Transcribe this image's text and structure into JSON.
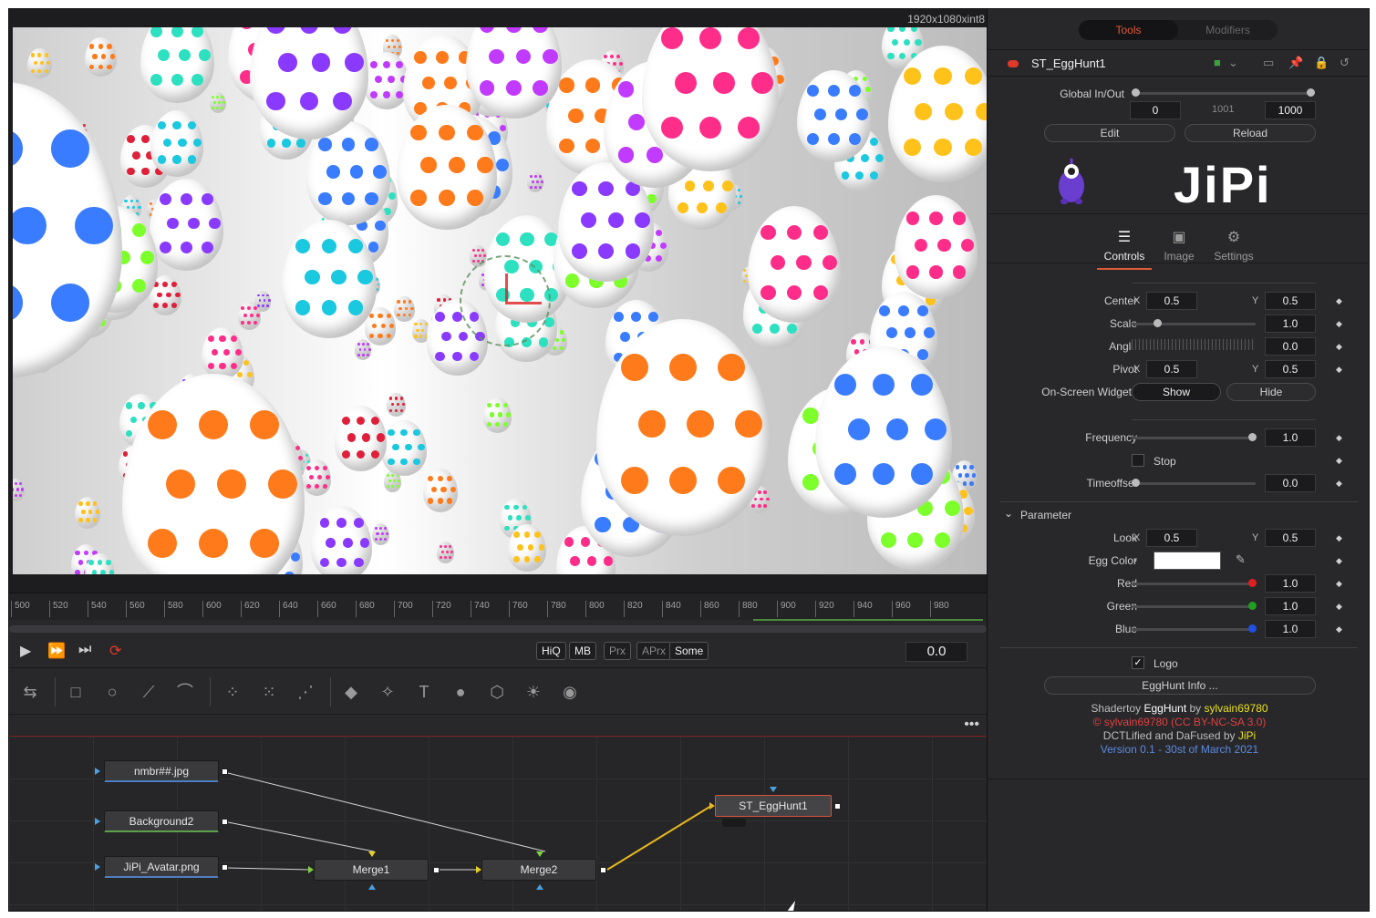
{
  "viewer": {
    "resolution": "1920x1080xint8"
  },
  "ruler": {
    "ticks": [
      "500",
      "520",
      "540",
      "560",
      "580",
      "600",
      "620",
      "640",
      "660",
      "680",
      "700",
      "720",
      "740",
      "760",
      "780",
      "800",
      "820",
      "840",
      "860",
      "880",
      "900",
      "920",
      "940",
      "960",
      "980"
    ]
  },
  "transport": {
    "quality_buttons": [
      "HiQ",
      "MB",
      "Prx",
      "APrx",
      "Some"
    ],
    "time": "0.0"
  },
  "nodes": {
    "n1": "nmbr##.jpg",
    "n2": "Background2",
    "n3": "JiPi_Avatar.png",
    "merge1": "Merge1",
    "merge2": "Merge2",
    "st": "ST_EggHunt1"
  },
  "inspector": {
    "tabs": {
      "tools": "Tools",
      "modifiers": "Modifiers"
    },
    "tool_name": "ST_EggHunt1",
    "global_inout_label": "Global In/Out",
    "global_in": "0",
    "global_mid": "1001",
    "global_out": "1000",
    "edit_label": "Edit",
    "reload_label": "Reload",
    "logo_text": "JiPi",
    "ctrl_tabs": {
      "controls": "Controls",
      "image": "Image",
      "settings": "Settings"
    },
    "center_label": "Center",
    "center_x": "0.5",
    "center_y": "0.5",
    "scale_label": "Scale",
    "scale": "1.0",
    "angle_label": "Angle",
    "angle": "0.0",
    "pivot_label": "Pivot",
    "pivot_x": "0.5",
    "pivot_y": "0.5",
    "widgets_label": "On-Screen Widgets",
    "show": "Show",
    "hide": "Hide",
    "frequency_label": "Frequency",
    "frequency": "1.0",
    "stop_label": "Stop",
    "timeoffset_label": "Timeoffset",
    "timeoffset": "0.0",
    "parameter_label": "Parameter",
    "look_label": "Look",
    "look_x": "0.5",
    "look_y": "0.5",
    "eggcolor_label": "Egg Color",
    "red_label": "Red",
    "red": "1.0",
    "green_label": "Green",
    "green": "1.0",
    "blue_label": "Blue",
    "blue": "1.0",
    "logo_label": "Logo",
    "info_label": "EggHunt Info ...",
    "x_axis": "X",
    "y_axis": "Y"
  },
  "credits": {
    "line1_a": "Shadertoy ",
    "line1_b": "EggHunt",
    "line1_c": " by ",
    "line1_d": "sylvain69780",
    "line2": "© sylvain69780 (CC BY-NC-SA 3.0)",
    "line3_a": "DCTLified and DaFused by ",
    "line3_b": "JiPi",
    "line4": "Version 0.1 - 30st of March 2021"
  },
  "colors": {
    "accent": "#e05a3a",
    "selected_node": "#d9523a",
    "wire_yellow": "#e8b820"
  }
}
